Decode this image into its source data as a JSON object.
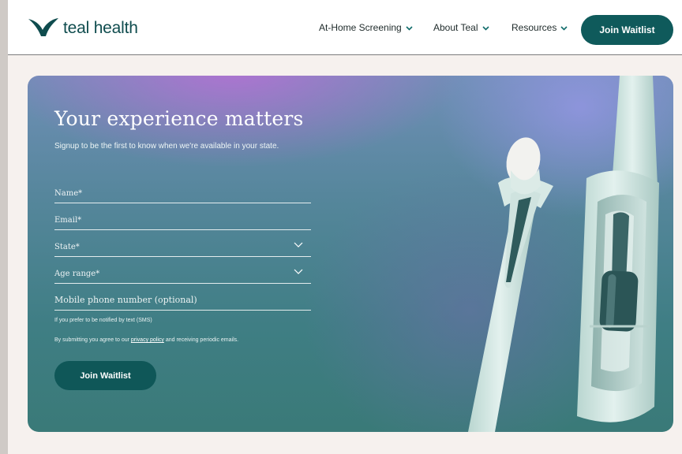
{
  "brand": {
    "name": "teal health"
  },
  "nav": {
    "items": [
      {
        "label": "At-Home Screening"
      },
      {
        "label": "About Teal"
      },
      {
        "label": "Resources"
      }
    ],
    "cta_label": "Join Waitlist"
  },
  "hero": {
    "title": "Your experience matters",
    "subtitle": "Signup to be the first to know when we're available in your state.",
    "fields": {
      "name_placeholder": "Name*",
      "email_placeholder": "Email*",
      "state_label": "State*",
      "age_label": "Age range*",
      "phone_placeholder": "Mobile phone number (optional)"
    },
    "sms_note": "If you prefer to be notified by text (SMS)",
    "consent_prefix": "By submitting you agree to our ",
    "consent_link": "privacy policy",
    "consent_suffix": " and receiving periodic emails.",
    "submit_label": "Join Waitlist"
  },
  "colors": {
    "brand_teal": "#0f5a5b",
    "page_bg": "#f6f1ee",
    "device_body": "#cfe4df"
  },
  "icons": {
    "logo": "bird-logo-icon",
    "nav_chevron": "chevron-down-icon",
    "select_chevron": "chevron-down-icon"
  }
}
